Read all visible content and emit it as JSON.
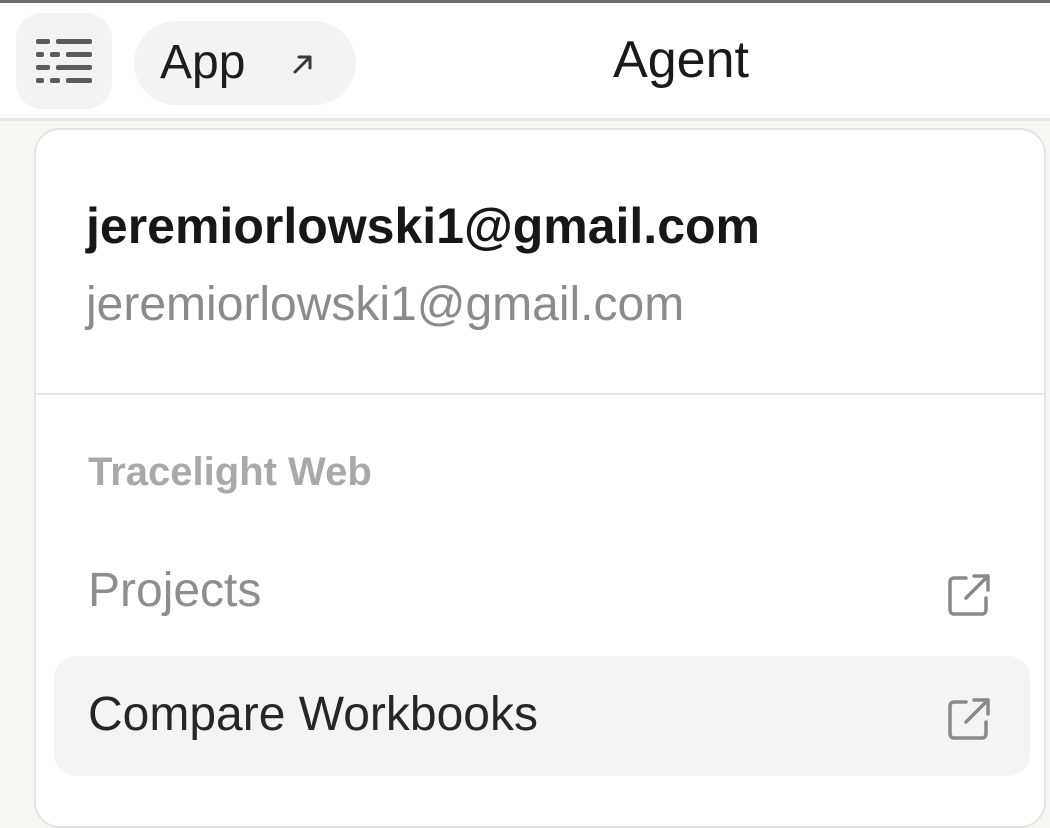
{
  "header": {
    "menu_icon": "sidebar-menu-icon",
    "app_label": "App",
    "app_icon": "arrow-up-right-icon",
    "tabs": [
      {
        "label": "Agent",
        "active": true
      }
    ],
    "accent_color": "#3aa56d"
  },
  "account_menu": {
    "user_name": "jeremiorlowski1@gmail.com",
    "user_email": "jeremiorlowski1@gmail.com",
    "section_heading": "Tracelight Web",
    "items": [
      {
        "label": "Projects",
        "icon": "external-link-icon",
        "highlighted": false
      },
      {
        "label": "Compare Workbooks",
        "icon": "external-link-icon",
        "highlighted": true
      }
    ]
  }
}
